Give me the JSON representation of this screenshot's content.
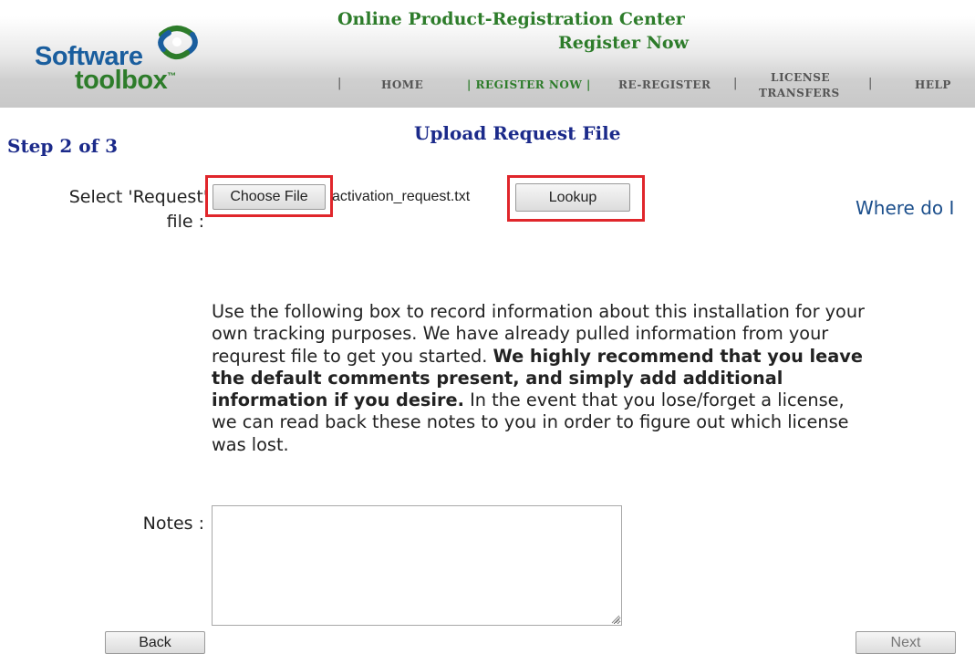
{
  "header": {
    "logo_word1": "Software",
    "logo_word2": "toolbox",
    "logo_tm": "™",
    "title": "Online Product-Registration Center",
    "subtitle": "Register Now",
    "nav": {
      "sep": "|",
      "home": "HOME",
      "register_now": "| REGISTER NOW |",
      "reregister": "RE-REGISTER",
      "license_line1": "LICENSE",
      "license_line2": "TRANSFERS",
      "help": "HELP"
    }
  },
  "step": "Step 2 of 3",
  "page_title": "Upload Request File",
  "upload": {
    "label_line1": "Select 'Request'",
    "label_line2": "file :",
    "choose_file_label": "Choose File",
    "file_name": "activation_request.txt",
    "lookup_label": "Lookup",
    "where_text": "Where do I"
  },
  "info": {
    "intro": "Use the following box to record information about this installation for your own tracking purposes. We have already pulled information from your requrest file to get you started.",
    "bold": "We highly recommend that you leave the default comments present, and simply add additional information if you desire.",
    "outro": "In the event that you lose/forget a license, we can read back these notes to you in order to figure out which license was lost."
  },
  "notes": {
    "label": "Notes :",
    "value": ""
  },
  "buttons": {
    "back": "Back",
    "next": "Next"
  },
  "colors": {
    "brand_green": "#2d7c2a",
    "brand_blue": "#1a5e9e",
    "heading_blue": "#1b2a8a",
    "highlight_red": "#e0262b"
  }
}
